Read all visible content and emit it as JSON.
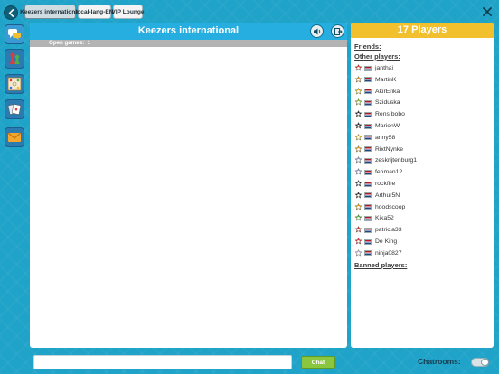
{
  "top_bar": {
    "tabs": [
      {
        "label": "Keezers international",
        "active": true
      },
      {
        "label": "local-lang-EN",
        "active": false
      },
      {
        "label": "VIP Lounge",
        "active": false
      }
    ]
  },
  "side_menu": [
    {
      "name": "chat-bubbles-icon"
    },
    {
      "name": "pawns-icon"
    },
    {
      "name": "board-icon"
    },
    {
      "name": "cards-icon"
    },
    {
      "name": "mail-icon"
    }
  ],
  "main": {
    "title": "Keezers international",
    "open_games_label": "Open games:",
    "open_games_count": "1"
  },
  "players": {
    "header": "17 Players",
    "friends_label": "Friends:",
    "other_label": "Other players:",
    "banned_label": "Banned players:",
    "list": [
      {
        "name": "janthai",
        "rank_color": "#d9352b"
      },
      {
        "name": "MartinK",
        "rank_color": "#e0a21b"
      },
      {
        "name": "AkirErika",
        "rank_color": "#e5c21f"
      },
      {
        "name": "Sziduska",
        "rank_color": "#9fc53a"
      },
      {
        "name": "Rens bobo",
        "rank_color": "#2a2a2a"
      },
      {
        "name": "MarionW",
        "rank_color": "#2a2a2a"
      },
      {
        "name": "anny58",
        "rank_color": "#e5c21f"
      },
      {
        "name": "RixtNynke",
        "rank_color": "#e0a21b"
      },
      {
        "name": "zeskrijtenburg1",
        "rank_color": "#9aa6c8"
      },
      {
        "name": "fenman12",
        "rank_color": "#9aa6c8"
      },
      {
        "name": "rockfire",
        "rank_color": "#2a2a2a"
      },
      {
        "name": "Arthur5N",
        "rank_color": "#2a2a2a"
      },
      {
        "name": "hoodscoop",
        "rank_color": "#e0a21b"
      },
      {
        "name": "Kika52",
        "rank_color": "#5aa83a"
      },
      {
        "name": "patricia33",
        "rank_color": "#d9352b"
      },
      {
        "name": "De King",
        "rank_color": "#d9352b"
      },
      {
        "name": "ninja0827",
        "rank_color": "#c7ccd6"
      }
    ]
  },
  "bottom": {
    "chat_placeholder": "",
    "chat_button": "Chat",
    "chatrooms_label": "Chatrooms:",
    "chatrooms_enabled": false
  }
}
